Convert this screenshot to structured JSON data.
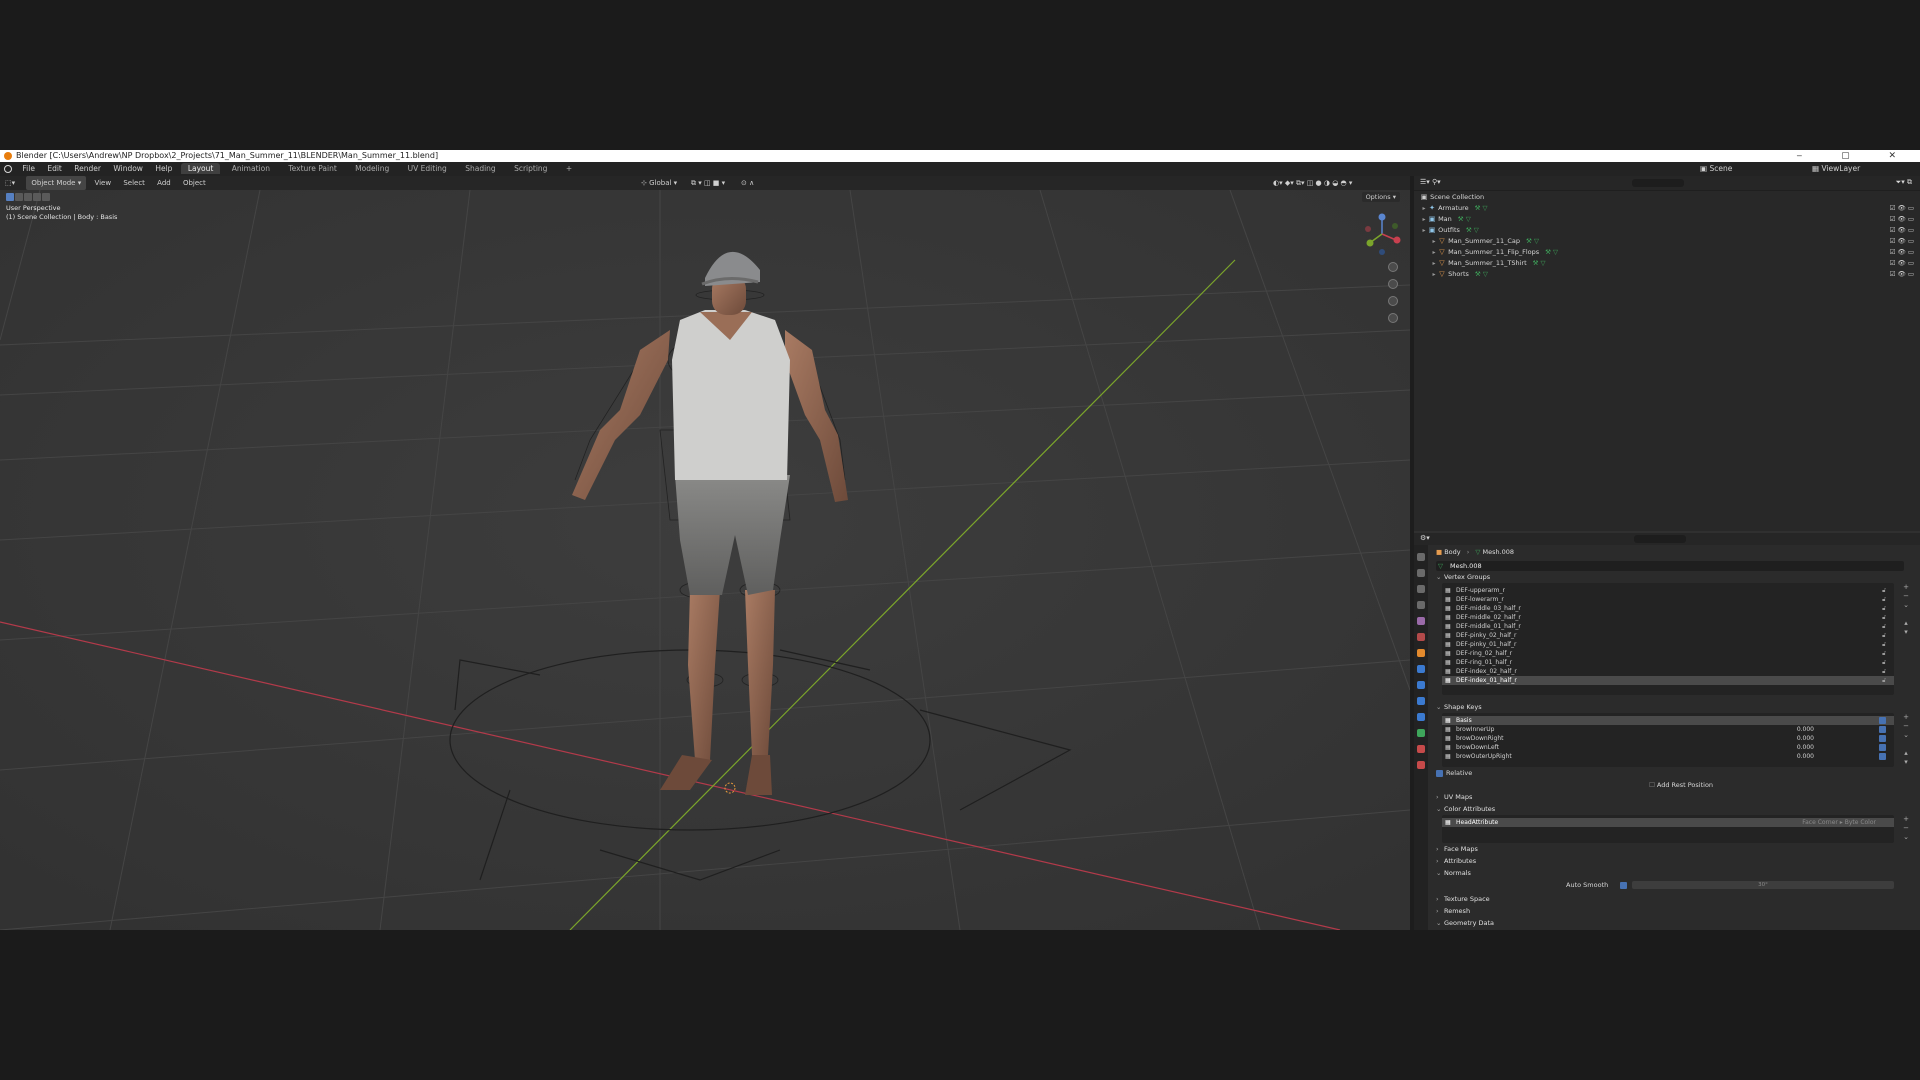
{
  "window": {
    "title": "Blender [C:\\Users\\Andrew\\NP Dropbox\\2_Projects\\71_Man_Summer_11\\BLENDER\\Man_Summer_11.blend]"
  },
  "menubar": {
    "menus": [
      "File",
      "Edit",
      "Render",
      "Window",
      "Help"
    ],
    "workspaces": [
      "Layout",
      "Animation",
      "Texture Paint",
      "Modeling",
      "UV Editing",
      "Shading",
      "Scripting",
      "+"
    ],
    "active_workspace": "Layout",
    "scene": "Scene",
    "view_layer": "ViewLayer"
  },
  "viewport": {
    "mode": "Object Mode",
    "menus": [
      "View",
      "Select",
      "Add",
      "Object"
    ],
    "orientation": "Global",
    "options": "Options",
    "perspective": "User Perspective",
    "collection_info": "(1) Scene Collection | Body : Basis"
  },
  "outliner": {
    "root": "Scene Collection",
    "rows": [
      {
        "name": "Armature",
        "icon": "armature-icon",
        "indent": 1,
        "color": "#8fc5e8"
      },
      {
        "name": "Man",
        "icon": "collection-icon",
        "indent": 1,
        "color": "#8fc5e8"
      },
      {
        "name": "Outfits",
        "icon": "collection-icon",
        "indent": 1,
        "color": "#8fc5e8"
      },
      {
        "name": "Man_Summer_11_Cap",
        "icon": "mesh-icon",
        "indent": 2,
        "color": "#e69c4f"
      },
      {
        "name": "Man_Summer_11_Flip_Flops",
        "icon": "mesh-icon",
        "indent": 2,
        "color": "#e69c4f"
      },
      {
        "name": "Man_Summer_11_TShirt",
        "icon": "mesh-icon",
        "indent": 2,
        "color": "#e69c4f"
      },
      {
        "name": "Shorts",
        "icon": "mesh-icon",
        "indent": 2,
        "color": "#e69c4f"
      }
    ]
  },
  "properties": {
    "breadcrumb": {
      "object": "Body",
      "data": "Mesh.008"
    },
    "mesh_name": "Mesh.008",
    "vertex_groups": {
      "title": "Vertex Groups",
      "items": [
        "DEF-upperarm_r",
        "DEF-lowerarm_r",
        "DEF-middle_03_half_r",
        "DEF-middle_02_half_r",
        "DEF-middle_01_half_r",
        "DEF-pinky_02_half_r",
        "DEF-pinky_01_half_r",
        "DEF-ring_02_half_r",
        "DEF-ring_01_half_r",
        "DEF-index_02_half_r",
        "DEF-index_01_half_r"
      ],
      "selected_index": 10
    },
    "shape_keys": {
      "title": "Shape Keys",
      "items": [
        {
          "name": "Basis",
          "value": ""
        },
        {
          "name": "browInnerUp",
          "value": "0.000"
        },
        {
          "name": "browDownRight",
          "value": "0.000"
        },
        {
          "name": "browDownLeft",
          "value": "0.000"
        },
        {
          "name": "browOuterUpRight",
          "value": "0.000"
        }
      ],
      "relative_label": "Relative",
      "add_rest_position": "Add Rest Position"
    },
    "uv_maps": "UV Maps",
    "color_attributes": {
      "title": "Color Attributes",
      "item": "HeadAttribute",
      "domain": "Face Corner ▸ Byte Color"
    },
    "face_maps": "Face Maps",
    "attributes": "Attributes",
    "normals": {
      "title": "Normals",
      "auto_smooth": "Auto Smooth",
      "angle": "30°"
    },
    "texture_space": "Texture Space",
    "remesh": "Remesh",
    "geometry_data": "Geometry Data"
  },
  "colors": {
    "x_axis": "#b33a4a",
    "y_axis": "#7ba52b",
    "accent": "#4772b3",
    "grid": "#454545"
  }
}
